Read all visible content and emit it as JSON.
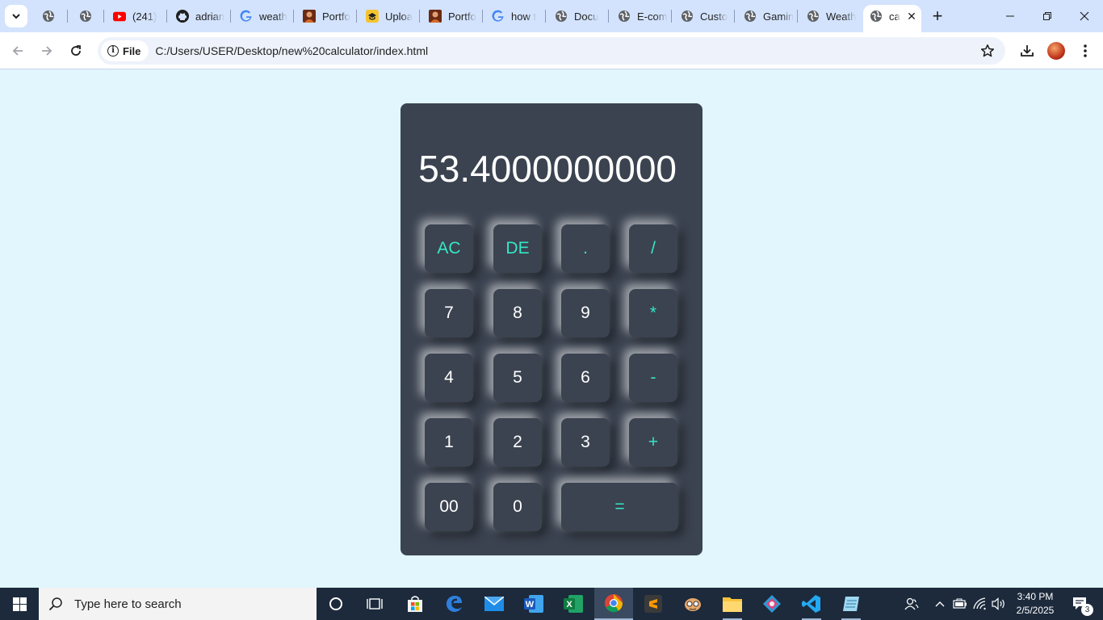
{
  "browser": {
    "tabs": [
      {
        "title": "",
        "icon": "globe-icon"
      },
      {
        "title": "",
        "icon": "globe-icon"
      },
      {
        "title": "(241)",
        "icon": "youtube-icon"
      },
      {
        "title": "adrian",
        "icon": "github-icon"
      },
      {
        "title": "weath",
        "icon": "google-icon"
      },
      {
        "title": "Portfo",
        "icon": "portrait-icon"
      },
      {
        "title": "Uploa",
        "icon": "upload-icon"
      },
      {
        "title": "Portfo",
        "icon": "portrait-icon"
      },
      {
        "title": "how t",
        "icon": "google-icon"
      },
      {
        "title": "Docu",
        "icon": "globe-icon"
      },
      {
        "title": "E-com",
        "icon": "globe-icon"
      },
      {
        "title": "Custo",
        "icon": "globe-icon"
      },
      {
        "title": "Gamin",
        "icon": "globe-icon"
      },
      {
        "title": "Weath",
        "icon": "globe-icon"
      },
      {
        "title": "ca",
        "icon": "globe-icon"
      }
    ],
    "omnibox": {
      "chip_label": "File",
      "url": "C:/Users/USER/Desktop/new%20calculator/index.html"
    }
  },
  "calculator": {
    "display": "53.4000000000",
    "keys": [
      {
        "label": "AC",
        "kind": "op"
      },
      {
        "label": "DE",
        "kind": "op"
      },
      {
        "label": ".",
        "kind": "op"
      },
      {
        "label": "/",
        "kind": "op"
      },
      {
        "label": "7",
        "kind": "num"
      },
      {
        "label": "8",
        "kind": "num"
      },
      {
        "label": "9",
        "kind": "num"
      },
      {
        "label": "*",
        "kind": "op"
      },
      {
        "label": "4",
        "kind": "num"
      },
      {
        "label": "5",
        "kind": "num"
      },
      {
        "label": "6",
        "kind": "num"
      },
      {
        "label": "-",
        "kind": "op"
      },
      {
        "label": "1",
        "kind": "num"
      },
      {
        "label": "2",
        "kind": "num"
      },
      {
        "label": "3",
        "kind": "num"
      },
      {
        "label": "+",
        "kind": "op"
      },
      {
        "label": "00",
        "kind": "num"
      },
      {
        "label": "0",
        "kind": "num"
      },
      {
        "label": "=",
        "kind": "op"
      }
    ]
  },
  "taskbar": {
    "search_placeholder": "Type here to search",
    "time": "3:40 PM",
    "date": "2/5/2025",
    "notification_count": "3"
  },
  "colors": {
    "page_background": "#e1f6fd",
    "calculator_body": "#3b4350",
    "operator_text": "#35e7c6",
    "number_text": "#ffffff",
    "tabstrip": "#d3e3fd",
    "taskbar": "#1c2a3c"
  }
}
